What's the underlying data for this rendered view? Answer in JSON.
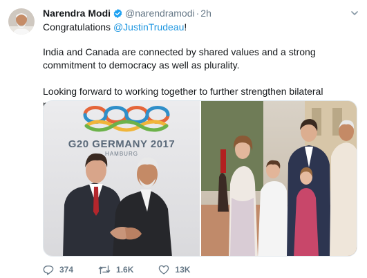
{
  "tweet": {
    "author_name": "Narendra Modi",
    "handle": "@narendramodi",
    "separator": "·",
    "time": "2h",
    "line1_prefix": "Congratulations ",
    "line1_mention": "@JustinTrudeau",
    "line1_suffix": "!",
    "paragraph2": "India and Canada are connected by shared values and a strong commitment to democracy as well as plurality.",
    "paragraph3": "Looking forward to working together to further strengthen bilateral relations.",
    "logo_title": "G20 GERMANY 2017",
    "logo_city": "HAMBURG"
  },
  "actions": {
    "replies": "374",
    "retweets": "1.6K",
    "likes": "13K"
  },
  "colors": {
    "link": "#1b95e0",
    "muted": "#657786",
    "verified": "#1da1f2"
  },
  "icons": [
    "chevron-down-icon",
    "verified-badge-icon",
    "reply-icon",
    "retweet-icon",
    "like-icon"
  ]
}
